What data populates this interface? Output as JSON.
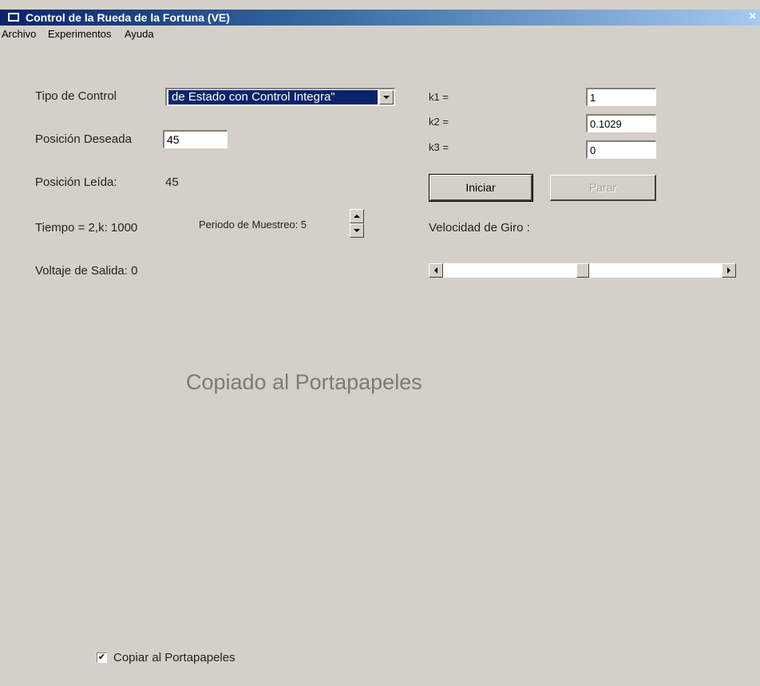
{
  "window": {
    "title": "Control de la Rueda de la Fortuna (VE)",
    "close_glyph": "×"
  },
  "menu": {
    "items": [
      "Archivo",
      "Experimentos",
      "Ayuda"
    ]
  },
  "controls": {
    "tipo_control_label": "Tipo de Control",
    "tipo_control_value": " de Estado con Control Integra\"",
    "posicion_deseada_label": "Posición Deseada",
    "posicion_deseada_value": "45",
    "posicion_leida_label": "Posición Leída:",
    "posicion_leida_value": "45",
    "tiempo_text": "Tiempo = 2,k: 1000",
    "periodo_text": "Periodo de Muestreo: 5",
    "voltaje_text": "Voltaje de Salida: 0"
  },
  "gains": {
    "k1_label": "k1 =",
    "k1_value": "1",
    "k2_label": "k2 =",
    "k2_value": "0.1029",
    "k3_label": "k3 =",
    "k3_value": "0"
  },
  "buttons": {
    "iniciar": "Iniciar",
    "parar": "Parar"
  },
  "velocidad": {
    "label": "Velocidad de Giro :",
    "slider_position": 0.5
  },
  "status_message": "Copiado al Portapapeles",
  "copy_checkbox": {
    "label": "Copiar al Portapapeles",
    "checked": true,
    "check_glyph": "✔"
  },
  "colors": {
    "window_bg": "#d4d0c8",
    "title_bar": "#0a246a",
    "selection": "#0a246a"
  }
}
